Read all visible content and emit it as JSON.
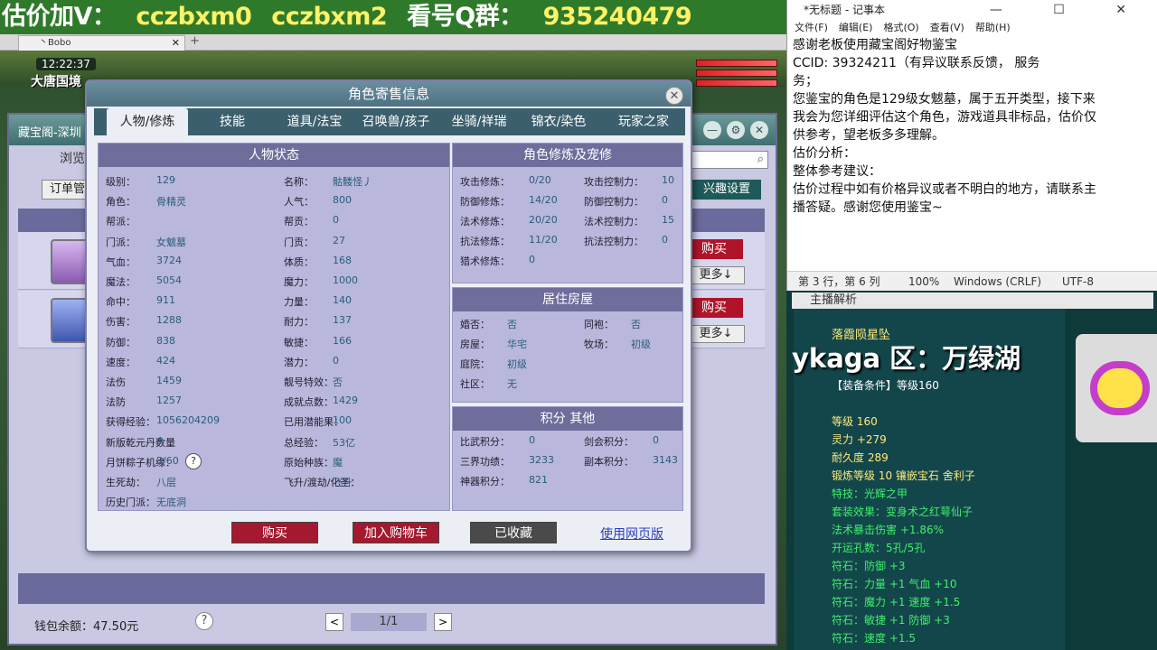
{
  "banner": {
    "parts": [
      "估价加V：",
      "cczbxm0",
      "cczbxm2",
      "看号Q群：",
      "935240479"
    ]
  },
  "browser": {
    "tab_title": "丶Bobo",
    "close": "✕",
    "new_tab": "+"
  },
  "game": {
    "time": "12:22:37",
    "location": "大唐国境"
  },
  "shop": {
    "header_title": "藏宝阁-深圳",
    "browse": "浏览",
    "order_button": "订单管",
    "interest_button": "兴趣设置",
    "buy_label": "购买",
    "more_label": "更多↓",
    "wallet": "钱包余额：47.50元",
    "help": "?",
    "page": "1/1",
    "prev": "<",
    "next": ">",
    "window_icons": [
      "—",
      "⚙",
      "✕"
    ]
  },
  "dialog": {
    "title": "角色寄售信息",
    "close": "✕",
    "tabs": [
      "人物/修炼",
      "技能",
      "道具/法宝",
      "召唤兽/孩子",
      "坐骑/祥瑞",
      "锦衣/染色",
      "玩家之家"
    ],
    "status_header": "人物状态",
    "status_left": [
      {
        "k": "级别：",
        "v": "129"
      },
      {
        "k": "角色：",
        "v": "骨精灵"
      },
      {
        "k": "帮派：",
        "v": ""
      },
      {
        "k": "门派：",
        "v": "女魃墓"
      },
      {
        "k": "气血：",
        "v": "3724"
      },
      {
        "k": "魔法：",
        "v": "5054"
      },
      {
        "k": "命中：",
        "v": "911"
      },
      {
        "k": "伤害：",
        "v": "1288"
      },
      {
        "k": "防御：",
        "v": "838"
      },
      {
        "k": "速度：",
        "v": "424"
      },
      {
        "k": "法伤",
        "v": "1459"
      },
      {
        "k": "法防",
        "v": "1257"
      },
      {
        "k": "获得经验：",
        "v": "1056204209"
      },
      {
        "k": "新版乾元丹数量",
        "v": "4"
      },
      {
        "k": "月饼粽子机缘：",
        "v": "3/60"
      },
      {
        "k": "生死劫：",
        "v": "八层"
      },
      {
        "k": "历史门派：",
        "v": "无底洞"
      }
    ],
    "status_right": [
      {
        "k": "名称：",
        "v": "骷髅怪丿"
      },
      {
        "k": "人气：",
        "v": "800"
      },
      {
        "k": "帮贡：",
        "v": "0"
      },
      {
        "k": "门贡：",
        "v": "27"
      },
      {
        "k": "体质：",
        "v": "168"
      },
      {
        "k": "魔力：",
        "v": "1000"
      },
      {
        "k": "力量：",
        "v": "140"
      },
      {
        "k": "耐力：",
        "v": "137"
      },
      {
        "k": "敏捷：",
        "v": "166"
      },
      {
        "k": "潜力：",
        "v": "0"
      },
      {
        "k": "靓号特效：",
        "v": "否"
      },
      {
        "k": "成就点数：",
        "v": "1429"
      },
      {
        "k": "已用潜能果：",
        "v": "100"
      },
      {
        "k": "总经验：",
        "v": "53亿"
      },
      {
        "k": "原始种族：",
        "v": "魔"
      },
      {
        "k": "飞升/渡劫/化圣：",
        "v": "飞升"
      }
    ],
    "cultivation_header": "角色修炼及宠修",
    "cultivation_left": [
      {
        "k": "攻击修炼：",
        "v": "0/20"
      },
      {
        "k": "防御修炼：",
        "v": "14/20"
      },
      {
        "k": "法术修炼：",
        "v": "20/20"
      },
      {
        "k": "抗法修炼：",
        "v": "11/20"
      },
      {
        "k": "猎术修炼：",
        "v": "0"
      }
    ],
    "cultivation_right": [
      {
        "k": "攻击控制力：",
        "v": "10"
      },
      {
        "k": "防御控制力：",
        "v": "0"
      },
      {
        "k": "法术控制力：",
        "v": "15"
      },
      {
        "k": "抗法控制力：",
        "v": "0"
      }
    ],
    "house_header": "居住房屋",
    "house_left": [
      {
        "k": "婚否：",
        "v": "否"
      },
      {
        "k": "房屋：",
        "v": "华宅"
      },
      {
        "k": "庭院：",
        "v": "初级"
      },
      {
        "k": "社区：",
        "v": "无"
      }
    ],
    "house_right": [
      {
        "k": "同袍：",
        "v": "否"
      },
      {
        "k": "牧场：",
        "v": "初级"
      }
    ],
    "points_header": "积分 其他",
    "points_left": [
      {
        "k": "比武积分：",
        "v": "0"
      },
      {
        "k": "三界功绩：",
        "v": "3233"
      },
      {
        "k": "神器积分：",
        "v": "821"
      }
    ],
    "points_right": [
      {
        "k": "剑会积分：",
        "v": "0"
      },
      {
        "k": "副本积分：",
        "v": "3143"
      }
    ],
    "buy_button": "购买",
    "cart_button": "加入购物车",
    "collected_button": "已收藏",
    "web_link": "使用网页版"
  },
  "notepad": {
    "title": "*无标题 - 记事本",
    "window_controls": "— ☐ ✕",
    "menu": [
      "文件(F)",
      "编辑(E)",
      "格式(O)",
      "查看(V)",
      "帮助(H)"
    ],
    "lines": [
      "感谢老板使用藏宝阁好物鉴宝",
      "CCID: 39324211（有异议联系反馈，        服务",
      "务；",
      "您鉴宝的角色是129级女魃墓，属于五开类型，接下来",
      "我会为您详细评估这个角色，游戏道具非标品，估价仅",
      "供参考，望老板多多理解。",
      "估价分析：",
      "整体参考建议：",
      "估价过程中如有价格异议或者不明白的地方，请联系主",
      "播答疑。感谢您使用鉴宝~"
    ],
    "status": {
      "pos": "第 3 行，第 6 列",
      "zoom": "100%",
      "eol": "Windows (CRLF)",
      "enc": "UTF-8"
    }
  },
  "stream": {
    "live_label": "主播解析",
    "item_name": "落霞陨星坠",
    "server": "ykaga  区：万绿湖",
    "equip_cond": "【装备条件】等级160",
    "stats": [
      {
        "text": "等级 160",
        "c": "yellow"
      },
      {
        "text": "灵力 +279",
        "c": "yellow"
      },
      {
        "text": "耐久度 289",
        "c": "yellow"
      },
      {
        "text": "锻炼等级 10 镶嵌宝石 舍利子",
        "c": "yellow"
      },
      {
        "text": "特技：光辉之甲",
        "c": "green"
      },
      {
        "text": "套装效果：变身术之红萼仙子",
        "c": "green"
      },
      {
        "text": "法术暴击伤害 +1.86%",
        "c": "green"
      },
      {
        "text": "开运孔数：5孔/5孔",
        "c": "green"
      },
      {
        "text": "符石：防御 +3",
        "c": "green"
      },
      {
        "text": "符石：力量 +1 气血 +10",
        "c": "green"
      },
      {
        "text": "符石：魔力 +1 速度 +1.5",
        "c": "green"
      },
      {
        "text": "符石：敏捷 +1 防御 +3",
        "c": "green"
      },
      {
        "text": "符石：速度 +1.5",
        "c": "green"
      }
    ]
  }
}
